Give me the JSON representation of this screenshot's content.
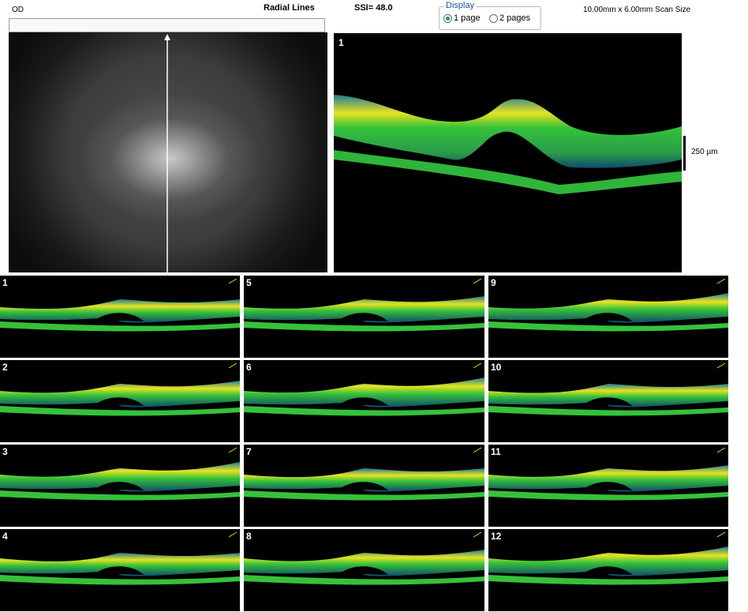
{
  "header": {
    "eye": "OD",
    "scan_type": "Radial Lines",
    "ssi": "SSI= 48.0",
    "scan_size": "10.00mm x 6.00mm Scan Size"
  },
  "display": {
    "legend": "Display",
    "options": [
      {
        "label": "1 page",
        "selected": true
      },
      {
        "label": "2 pages",
        "selected": false
      }
    ]
  },
  "main_scan": {
    "number": "1",
    "scale_label": "250 µm"
  },
  "thumbnails": [
    "1",
    "2",
    "3",
    "4",
    "5",
    "6",
    "7",
    "8",
    "9",
    "10",
    "11",
    "12"
  ],
  "colors": {
    "retina_green": "#35c23a",
    "retina_yellow": "#e8e320",
    "retina_red": "#e0501a",
    "background": "#000000"
  }
}
